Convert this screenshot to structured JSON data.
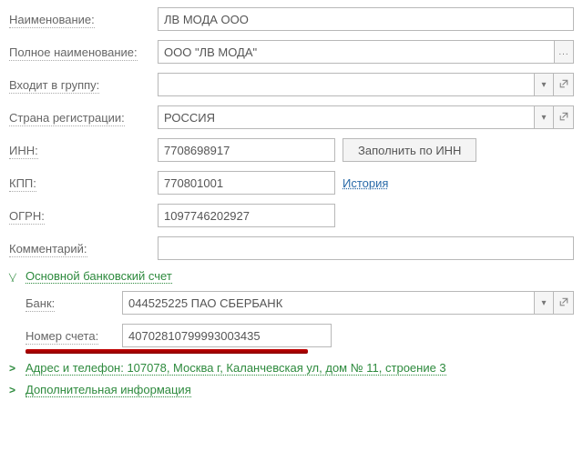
{
  "labels": {
    "name": "Наименование:",
    "full_name": "Полное наименование:",
    "group": "Входит в группу:",
    "country": "Страна регистрации:",
    "inn": "ИНН:",
    "kpp": "КПП:",
    "ogrn": "ОГРН:",
    "comment": "Комментарий:",
    "bank": "Банк:",
    "account": "Номер счета:"
  },
  "values": {
    "name": "ЛВ МОДА ООО",
    "full_name": "ООО \"ЛВ МОДА\"",
    "group": "",
    "country": "РОССИЯ",
    "inn": "7708698917",
    "kpp": "770801001",
    "ogrn": "1097746202927",
    "comment": "",
    "bank": "044525225 ПАО СБЕРБАНК",
    "account": "40702810799993003435"
  },
  "buttons": {
    "fill_by_inn": "Заполнить по ИНН",
    "history": "История",
    "ellipsis": "..."
  },
  "sections": {
    "bank": "Основной банковский счет",
    "address": "Адрес и телефон: 107078, Москва г, Каланчевская ул, дом № 11, строение 3",
    "extra": "Дополнительная информация"
  },
  "icons": {
    "dropdown": "▾"
  }
}
